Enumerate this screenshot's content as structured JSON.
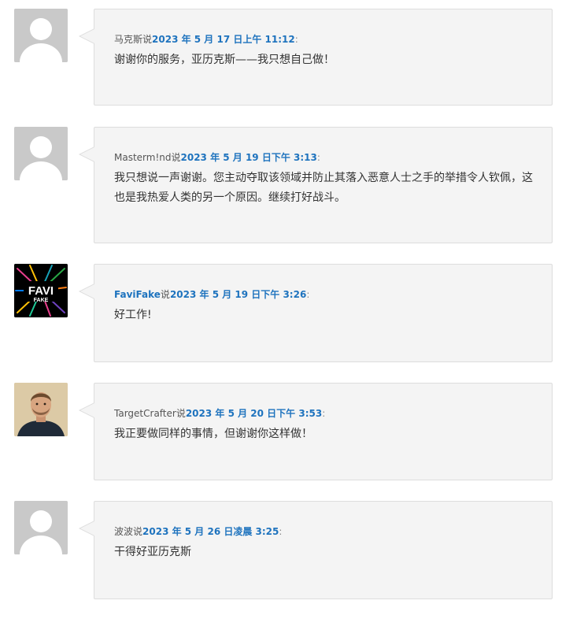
{
  "comments": [
    {
      "author": "马克斯说",
      "date": "2023 年 5 月 17 日上午 11:12",
      "colon": ":",
      "text": "谢谢你的服务，亚历克斯——我只想自己做！",
      "avatar": "default-avatar"
    },
    {
      "author": "Masterm!nd说",
      "date": "2023 年 5 月 19 日下午 3:13",
      "colon": ":",
      "text": "我只想说一声谢谢。您主动夺取该领域并防止其落入恶意人士之手的举措令人钦佩，这也是我热爱人类的另一个原因。继续打好战斗。",
      "avatar": "default-avatar"
    },
    {
      "author": "FaviFake",
      "author_suffix": "说",
      "date": "2023 年 5 月 19 日下午 3:26",
      "colon": ":",
      "text": "好工作!",
      "avatar": "favifake-logo",
      "logo_text_top": "FAVI",
      "logo_text_bottom": "FAKE"
    },
    {
      "author": "TargetCrafter说",
      "date": "2023 年 5 月 20 日下午 3:53",
      "colon": ":",
      "text": "我正要做同样的事情，但谢谢你这样做！",
      "avatar": "user-photo"
    },
    {
      "author": "波波说",
      "date": "2023 年 5 月 26 日凌晨 3:25",
      "colon": ":",
      "text": "干得好亚历克斯",
      "avatar": "default-avatar"
    }
  ],
  "colors": {
    "link": "#1e73be",
    "bubble_bg": "#f4f4f4",
    "bubble_border": "#dddddd",
    "avatar_default": "#c9c9c9"
  }
}
